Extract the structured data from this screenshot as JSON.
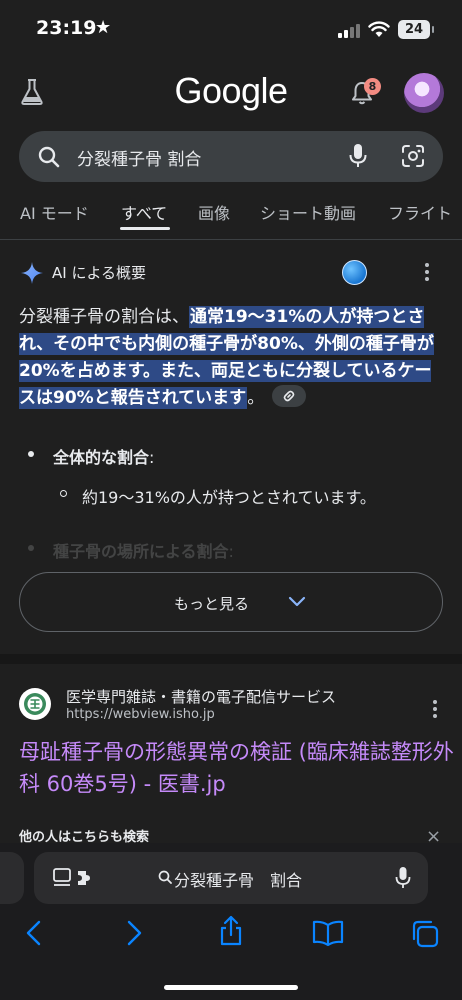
{
  "status_bar": {
    "time": "23:19",
    "star": "★",
    "battery": "24"
  },
  "header": {
    "logo": "Google",
    "notification_count": "8"
  },
  "search": {
    "query": "分裂種子骨 割合"
  },
  "tabs": [
    {
      "label": "AI モード"
    },
    {
      "label": "すべて"
    },
    {
      "label": "画像"
    },
    {
      "label": "ショート動画"
    },
    {
      "label": "フライト"
    }
  ],
  "ai_overview": {
    "title": "AI による概要",
    "intro": "分裂種子骨の割合は、",
    "highlight": "通常19〜31%の人が持つとされ、その中でも内側の種子骨が80%、外側の種子骨が20%を占めます。また、両足ともに分裂しているケースは90%と報告されています",
    "end": "。",
    "bullet1_title": "全体的な割合",
    "bullet1_colon": ":",
    "bullet1_sub": "約19〜31%の人が持つとされています。",
    "bullet2_title": "種子骨の場所による割合",
    "bullet2_colon": ":",
    "more_label": "もっと見る"
  },
  "result": {
    "site_name": "医学専門雑誌・書籍の電子配信サービス",
    "site_url": "https://webview.isho.jp",
    "title": "母趾種子骨の形態異常の検証 (臨床雑誌整形外科 60巻5号) - 医書.jp"
  },
  "also_search": {
    "label": "他の人はこちらも検索",
    "close": "×"
  },
  "safari": {
    "address_text": "分裂種子骨　割合"
  },
  "colors": {
    "highlight_bg": "#2e4a86",
    "link_purple": "#c58af9",
    "toolbar_blue": "#0a84ff"
  }
}
